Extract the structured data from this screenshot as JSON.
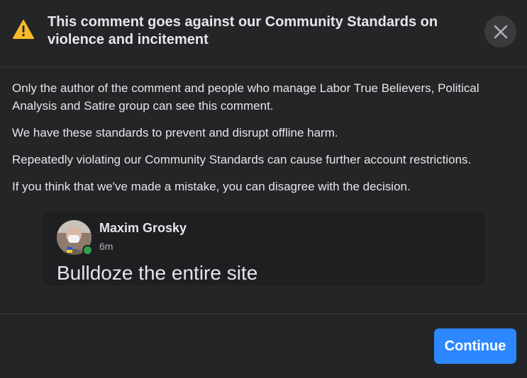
{
  "dialog": {
    "title": "This comment goes against our Community Standards on violence and incitement",
    "warning_icon": "warning-triangle-icon",
    "close_icon": "close-icon",
    "paragraphs": [
      "Only the author of the comment and people who manage Labor True Believers, Political Analysis and Satire group can see this comment.",
      "We have these standards to prevent and disrupt offline harm.",
      "Repeatedly violating our Community Standards can cause further account restrictions.",
      "If you think that we've made a mistake, you can disagree with the decision."
    ],
    "comment": {
      "author": "Maxim Grosky",
      "time": "6m",
      "text": "Bulldoze the entire site",
      "online": true
    },
    "continue_label": "Continue"
  },
  "colors": {
    "background": "#242526",
    "card": "#1e1f20",
    "accent": "#2d88ff",
    "warning": "#f7b928",
    "online": "#31a24c"
  }
}
